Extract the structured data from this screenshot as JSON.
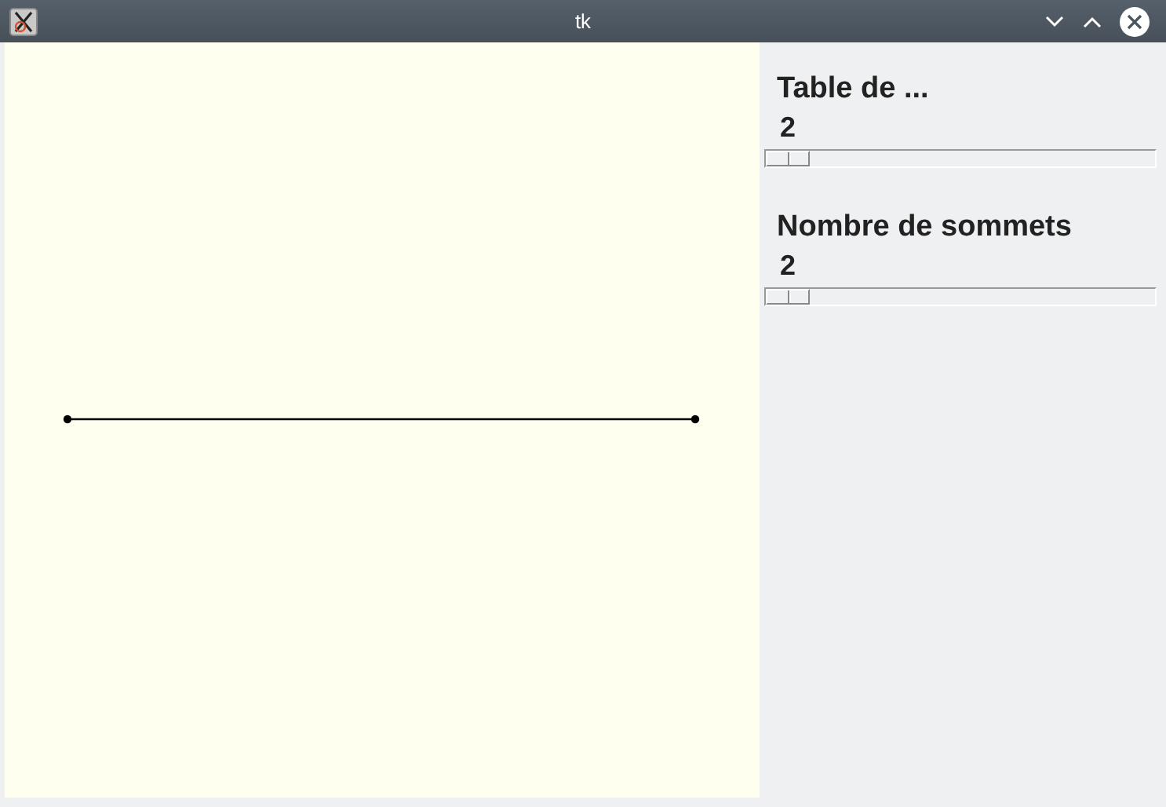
{
  "window": {
    "title": "tk"
  },
  "controls": [
    {
      "label": "Table de ...",
      "value": "2",
      "level": 0
    },
    {
      "label": "Nombre de sommets",
      "value": "2",
      "level": 0
    }
  ]
}
